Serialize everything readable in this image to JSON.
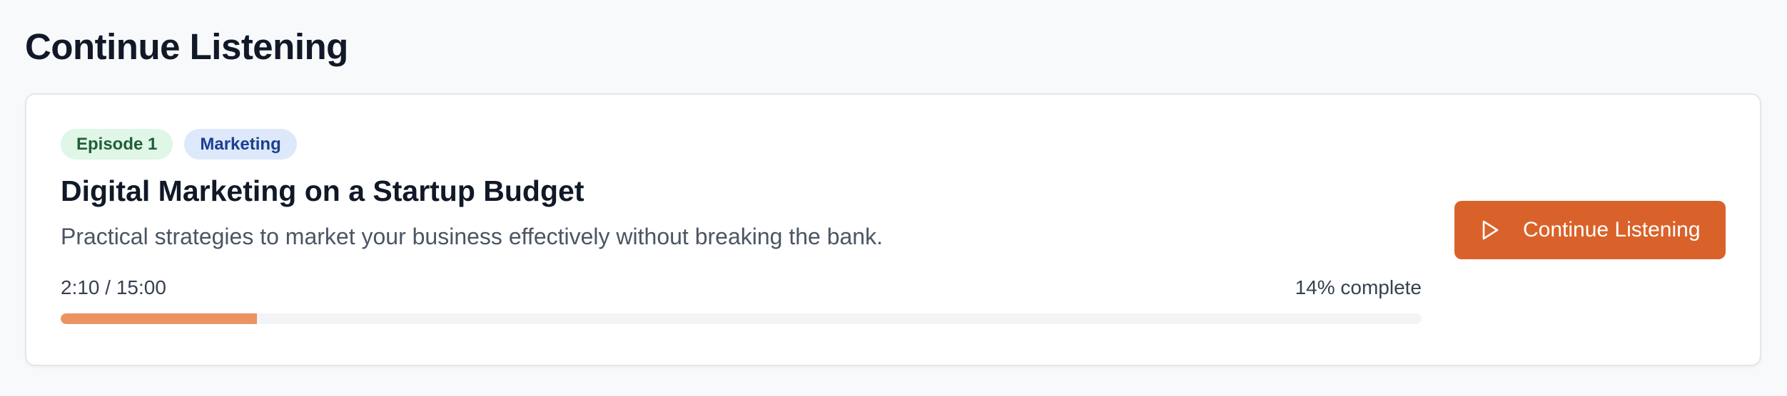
{
  "section": {
    "title": "Continue Listening"
  },
  "episode": {
    "episode_tag": "Episode 1",
    "category_tag": "Marketing",
    "title": "Digital Marketing on a Startup Budget",
    "description": "Practical strategies to market your business effectively without breaking the bank.",
    "time_display": "2:10 / 15:00",
    "percent_label": "14% complete",
    "progress_fraction": 0.1444,
    "progress_color": "#eb9462"
  },
  "actions": {
    "continue_label": "Continue Listening",
    "continue_icon": "play-icon",
    "accent_color": "#d9622b"
  },
  "colors": {
    "episode_tag_bg": "#e0f6e6",
    "category_tag_bg": "#dde8fa"
  }
}
